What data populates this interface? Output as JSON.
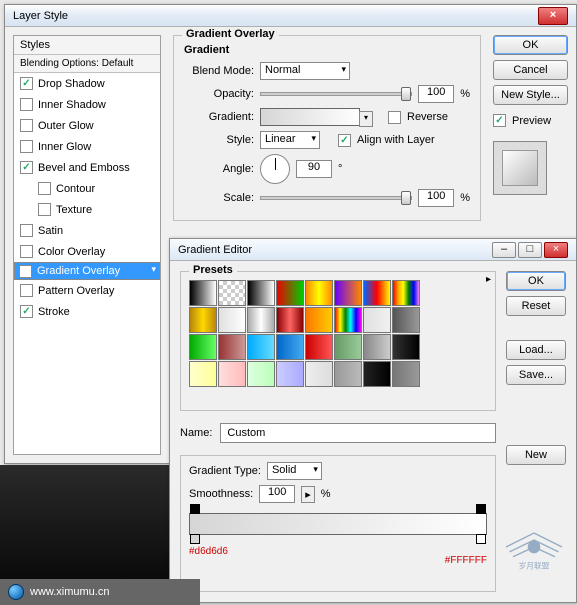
{
  "layerStyle": {
    "title": "Layer Style",
    "stylesHeader": "Styles",
    "blendingOptions": "Blending Options: Default",
    "items": [
      {
        "label": "Drop Shadow",
        "checked": true
      },
      {
        "label": "Inner Shadow",
        "checked": false
      },
      {
        "label": "Outer Glow",
        "checked": false
      },
      {
        "label": "Inner Glow",
        "checked": false
      },
      {
        "label": "Bevel and Emboss",
        "checked": true
      },
      {
        "label": "Contour",
        "checked": false,
        "indent": true
      },
      {
        "label": "Texture",
        "checked": false,
        "indent": true
      },
      {
        "label": "Satin",
        "checked": false
      },
      {
        "label": "Color Overlay",
        "checked": false
      },
      {
        "label": "Gradient Overlay",
        "checked": true,
        "selected": true
      },
      {
        "label": "Pattern Overlay",
        "checked": false
      },
      {
        "label": "Stroke",
        "checked": true
      }
    ],
    "section": {
      "title": "Gradient Overlay",
      "sub": "Gradient",
      "blendModeLabel": "Blend Mode:",
      "blendMode": "Normal",
      "opacityLabel": "Opacity:",
      "opacity": "100",
      "pct": "%",
      "gradientLabel": "Gradient:",
      "reverseLabel": "Reverse",
      "styleLabel": "Style:",
      "style": "Linear",
      "alignLabel": "Align with Layer",
      "angleLabel": "Angle:",
      "angle": "90",
      "deg": "°",
      "scaleLabel": "Scale:",
      "scale": "100"
    },
    "buttons": {
      "ok": "OK",
      "cancel": "Cancel",
      "newStyle": "New Style...",
      "preview": "Preview"
    }
  },
  "gradientEditor": {
    "title": "Gradient Editor",
    "presetsLabel": "Presets",
    "nameLabel": "Name:",
    "name": "Custom",
    "gradientTypeLabel": "Gradient Type:",
    "gradientType": "Solid",
    "smoothnessLabel": "Smoothness:",
    "smoothness": "100",
    "pct": "%",
    "hexLeft": "#d6d6d6",
    "hexRight": "#FFFFFF",
    "buttons": {
      "ok": "OK",
      "reset": "Reset",
      "load": "Load...",
      "save": "Save...",
      "new": "New"
    },
    "presets": [
      "linear-gradient(90deg,#000,#fff)",
      "repeating-conic-gradient(#ccc 0 25%,#fff 0 50%) 0/8px 8px",
      "linear-gradient(90deg,#000,#fff)",
      "linear-gradient(90deg,#e00,#0c0)",
      "linear-gradient(90deg,#f80,#ff0,#f80)",
      "linear-gradient(90deg,#60f,#f80)",
      "linear-gradient(90deg,#06f,#f00,#ff0)",
      "linear-gradient(90deg,red,orange,yellow,green,blue,violet)",
      "linear-gradient(90deg,#b8860b,#ffd700,#b8860b)",
      "linear-gradient(90deg,#e0e0e0,#fff)",
      "linear-gradient(90deg,#aaa,#fff,#aaa)",
      "linear-gradient(90deg,#800,#f66,#800)",
      "linear-gradient(90deg,#f70,#fc0)",
      "linear-gradient(90deg,red,yellow,green,cyan,blue,magenta)",
      "linear-gradient(90deg,#e0e0e0,#f0f0f0)",
      "linear-gradient(90deg,#555,#999)",
      "linear-gradient(90deg,#0a0,#6f6)",
      "linear-gradient(90deg,#933,#c99)",
      "linear-gradient(90deg,#0af,#6df)",
      "linear-gradient(90deg,#06c,#4ae)",
      "linear-gradient(90deg,#c00,#f55)",
      "linear-gradient(90deg,#696,#9c9)",
      "linear-gradient(90deg,#888,#ccc)",
      "linear-gradient(90deg,#333,#000)",
      "linear-gradient(90deg,#ffc,#ff9)",
      "linear-gradient(90deg,#fdd,#fbb)",
      "linear-gradient(90deg,#dfd,#bfb)",
      "linear-gradient(90deg,#ccf,#aaf)",
      "linear-gradient(90deg,#eee,#ddd)",
      "linear-gradient(90deg,#999,#bbb)",
      "linear-gradient(90deg,#222,#000)",
      "linear-gradient(90deg,#777,#999)"
    ]
  },
  "footer": {
    "url": "www.ximumu.cn"
  }
}
